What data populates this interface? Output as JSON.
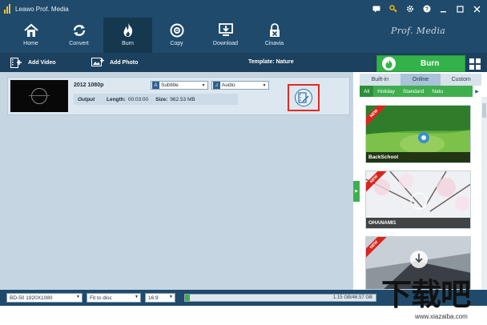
{
  "window": {
    "title": "Leawo Prof. Media"
  },
  "nav": {
    "items": [
      {
        "label": "Home",
        "icon": "home-icon"
      },
      {
        "label": "Convert",
        "icon": "convert-icon"
      },
      {
        "label": "Burn",
        "icon": "burn-icon",
        "active": true
      },
      {
        "label": "Copy",
        "icon": "copy-icon"
      },
      {
        "label": "Download",
        "icon": "download-icon"
      },
      {
        "label": "Cinavia",
        "icon": "cinavia-icon"
      }
    ],
    "brand": "Prof. Media"
  },
  "actions": {
    "add_video": "Add Video",
    "add_photo": "Add Photo",
    "template": "Template: Nature",
    "burn": "Burn"
  },
  "file": {
    "name": "2012 1080p",
    "subtitle": "Subtitle",
    "audio": "Audio",
    "output_label": "Output",
    "length_label": "Length:",
    "length": "00:03:00",
    "size_label": "Size:",
    "size": "962.53 MB"
  },
  "panel": {
    "tabs": [
      "Built-in",
      "Online",
      "Custom"
    ],
    "active_tab": "Online",
    "categories": [
      "All",
      "Holiday",
      "Standard",
      "Natu"
    ],
    "templates": [
      {
        "name": "BackSchool",
        "badge": "NEW"
      },
      {
        "name": "OHANAMI1",
        "badge": "NEW"
      },
      {
        "name": "",
        "badge": "NEW"
      }
    ]
  },
  "status": {
    "disc": "BD-50 1920X1080",
    "fit": "Fit to disc",
    "aspect": "16:9",
    "capacity": "1.15 GB/46.57 GB",
    "used_fraction": 0.025
  },
  "watermark": {
    "title": "下载吧",
    "url": "www.xiazaiba.com"
  },
  "colors": {
    "toolbar_bg": "#1f4a6b",
    "accent_green": "#3fae4f",
    "highlight_red": "#e02b24"
  }
}
